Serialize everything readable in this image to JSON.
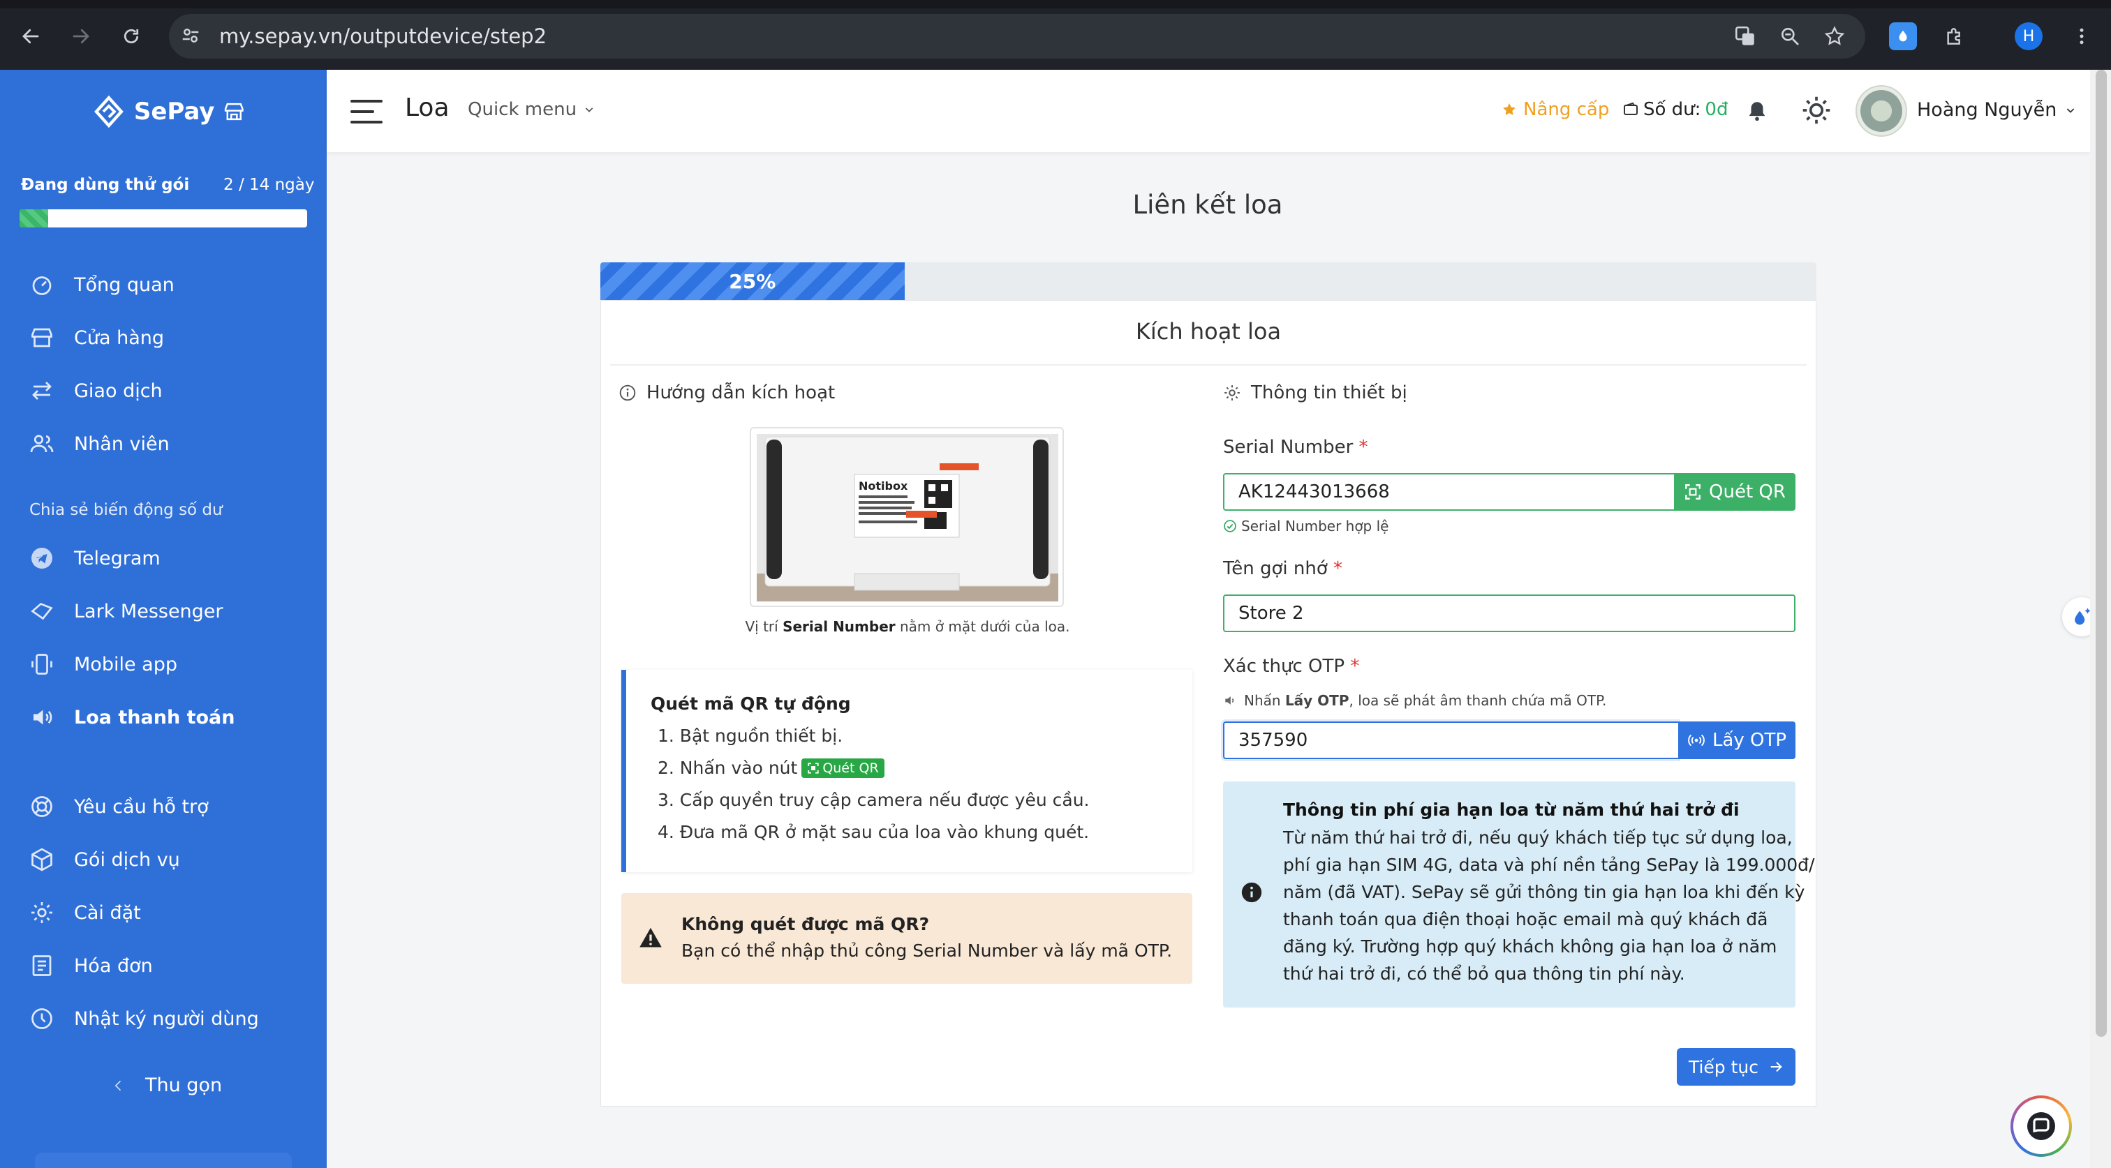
{
  "browser": {
    "url": "my.sepay.vn/outputdevice/step2",
    "profile_initial": "H"
  },
  "sidebar": {
    "brand": "SePay",
    "trial_label": "Đang dùng thử gói",
    "trial_days": "2 / 14 ngày",
    "trial_progress": 0.1,
    "items": [
      {
        "label": "Tổng quan",
        "icon": "dashboard-icon"
      },
      {
        "label": "Cửa hàng",
        "icon": "store-icon"
      },
      {
        "label": "Giao dịch",
        "icon": "transactions-icon"
      },
      {
        "label": "Nhân viên",
        "icon": "users-icon"
      }
    ],
    "section_label": "Chia sẻ biến động số dư",
    "share_items": [
      {
        "label": "Telegram",
        "icon": "telegram-icon"
      },
      {
        "label": "Lark Messenger",
        "icon": "lark-icon"
      },
      {
        "label": "Mobile app",
        "icon": "mobile-icon"
      },
      {
        "label": "Loa thanh toán",
        "icon": "speaker-icon",
        "active": true
      }
    ],
    "bottom_items": [
      {
        "label": "Yêu cầu hỗ trợ",
        "icon": "support-icon"
      },
      {
        "label": "Gói dịch vụ",
        "icon": "package-icon"
      },
      {
        "label": "Cài đặt",
        "icon": "settings-icon"
      },
      {
        "label": "Hóa đơn",
        "icon": "invoice-icon"
      },
      {
        "label": "Nhật ký người dùng",
        "icon": "history-icon"
      }
    ],
    "collapse_label": "Thu gọn"
  },
  "header": {
    "title": "Loa",
    "quick_menu": "Quick menu",
    "upgrade": "Nâng cấp",
    "balance_label": "Số dư:",
    "balance_value": "0đ",
    "user_name": "Hoàng Nguyễn"
  },
  "page": {
    "title": "Liên kết loa",
    "progress_label": "25%",
    "progress": 0.25,
    "card_title": "Kích hoạt loa",
    "guide": {
      "heading": "Hướng dẫn kích hoạt",
      "caption_pre": "Vị trí ",
      "caption_bold": "Serial Number",
      "caption_post": " nằm ở mặt dưới của loa.",
      "device_label": "Notibox",
      "qr_title": "Quét mã QR tự động",
      "steps": [
        "1. Bật nguồn thiết bị.",
        "2. Nhấn vào nút",
        "3. Cấp quyền truy cập camera nếu được yêu cầu.",
        "4. Đưa mã QR ở mặt sau của loa vào khung quét."
      ],
      "inline_qr_label": "Quét QR",
      "warn_title": "Không quét được mã QR?",
      "warn_text": "Bạn có thể nhập thủ công Serial Number và lấy mã OTP."
    },
    "device": {
      "heading": "Thông tin thiết bị",
      "serial_label": "Serial Number",
      "serial_value": "AK12443013668",
      "scan_button": "Quét QR",
      "serial_valid": "Serial Number hợp lệ",
      "nick_label": "Tên gợi nhớ",
      "nick_value": "Store 2",
      "otp_label": "Xác thực OTP",
      "otp_hint_pre": "Nhấn ",
      "otp_hint_bold": "Lấy OTP",
      "otp_hint_post": ", loa sẽ phát âm thanh chứa mã OTP.",
      "otp_value": "357590",
      "otp_button": "Lấy OTP",
      "required_mark": "*"
    },
    "fee": {
      "title": "Thông tin phí gia hạn loa từ năm thứ hai trở đi",
      "lines": [
        "Từ năm thứ hai trở đi, nếu quý khách tiếp tục sử dụng loa,",
        "phí gia hạn SIM 4G, data và phí nền tảng SePay là 199.000đ/",
        "năm (đã VAT). SePay sẽ gửi thông tin gia hạn loa khi đến kỳ",
        "thanh toán qua điện thoại hoặc email mà quý khách đã",
        "đăng ký. Trường hợp quý khách không gia hạn loa ở năm",
        "thứ hai trở đi, có thể bỏ qua thông tin phí này."
      ]
    },
    "continue_button": "Tiếp tục"
  },
  "colors": {
    "sidebar": "#2f6fd8",
    "primary": "#2f73e0",
    "success": "#3cb066",
    "warning_bg": "#f9e8d6",
    "info_bg": "#d7ecf7",
    "upgrade": "#f0a020"
  }
}
